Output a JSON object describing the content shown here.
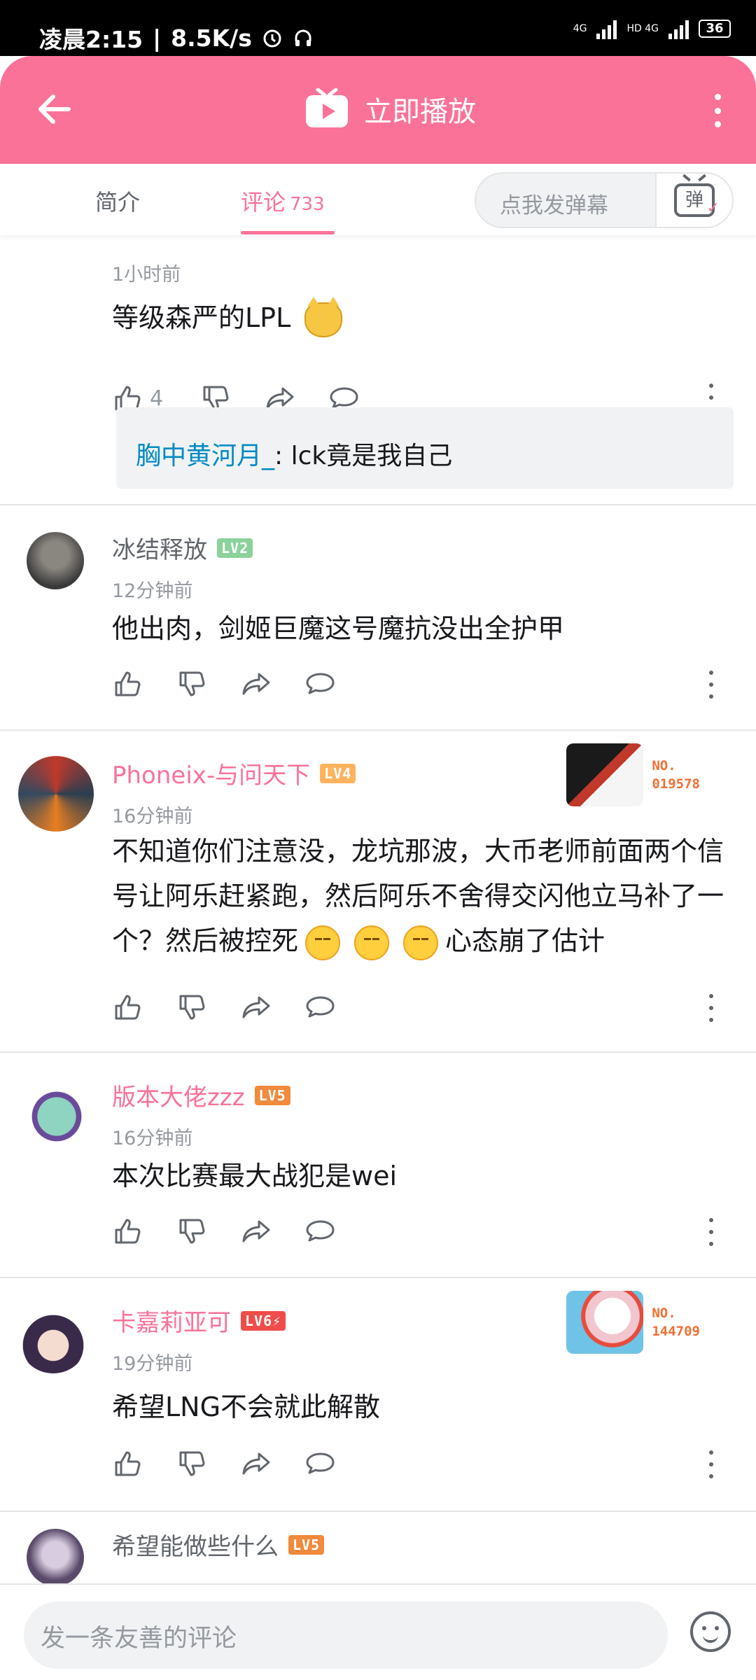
{
  "status_bar": {
    "time": "凌晨2:15",
    "speed": "8.5K/s",
    "net1": "4G",
    "net2": "HD 4G",
    "battery": "36"
  },
  "header": {
    "title": "立即播放",
    "accent_color": "#fb7299"
  },
  "tabs": {
    "intro": "简介",
    "comments": "评论",
    "comments_count": "733",
    "danmu_placeholder": "点我发弹幕",
    "danmu_icon_text": "弹"
  },
  "comments": [
    {
      "time": "1小时前",
      "content": "等级森严的LPL",
      "likes": "4",
      "reply": {
        "user": "胸中黄河月_",
        "text": ": lck竟是我自己"
      }
    },
    {
      "user": "冰结释放",
      "level": "LV2",
      "time": "12分钟前",
      "content": "他出肉，剑姬巨魔这号魔抗没出全护甲"
    },
    {
      "user": "Phoneix-与问天下",
      "level": "LV4",
      "time": "16分钟前",
      "content": "不知道你们注意没，龙坑那波，大币老师前面两个信号让阿乐赶紧跑，然后阿乐不舍得交闪他立马补了一个？然后被控死",
      "content_tail": "心态崩了估计",
      "badge_no_label": "NO.",
      "badge_no": "019578"
    },
    {
      "user": "版本大佬zzz",
      "level": "LV5",
      "time": "16分钟前",
      "content": "本次比赛最大战犯是wei"
    },
    {
      "user": "卡嘉莉亚可",
      "level": "LV6⚡",
      "time": "19分钟前",
      "content": "希望LNG不会就此解散",
      "badge_no_label": "NO.",
      "badge_no": "144709"
    },
    {
      "user": "希望能做些什么",
      "level": "LV5"
    }
  ],
  "bottom": {
    "input_placeholder": "发一条友善的评论"
  }
}
